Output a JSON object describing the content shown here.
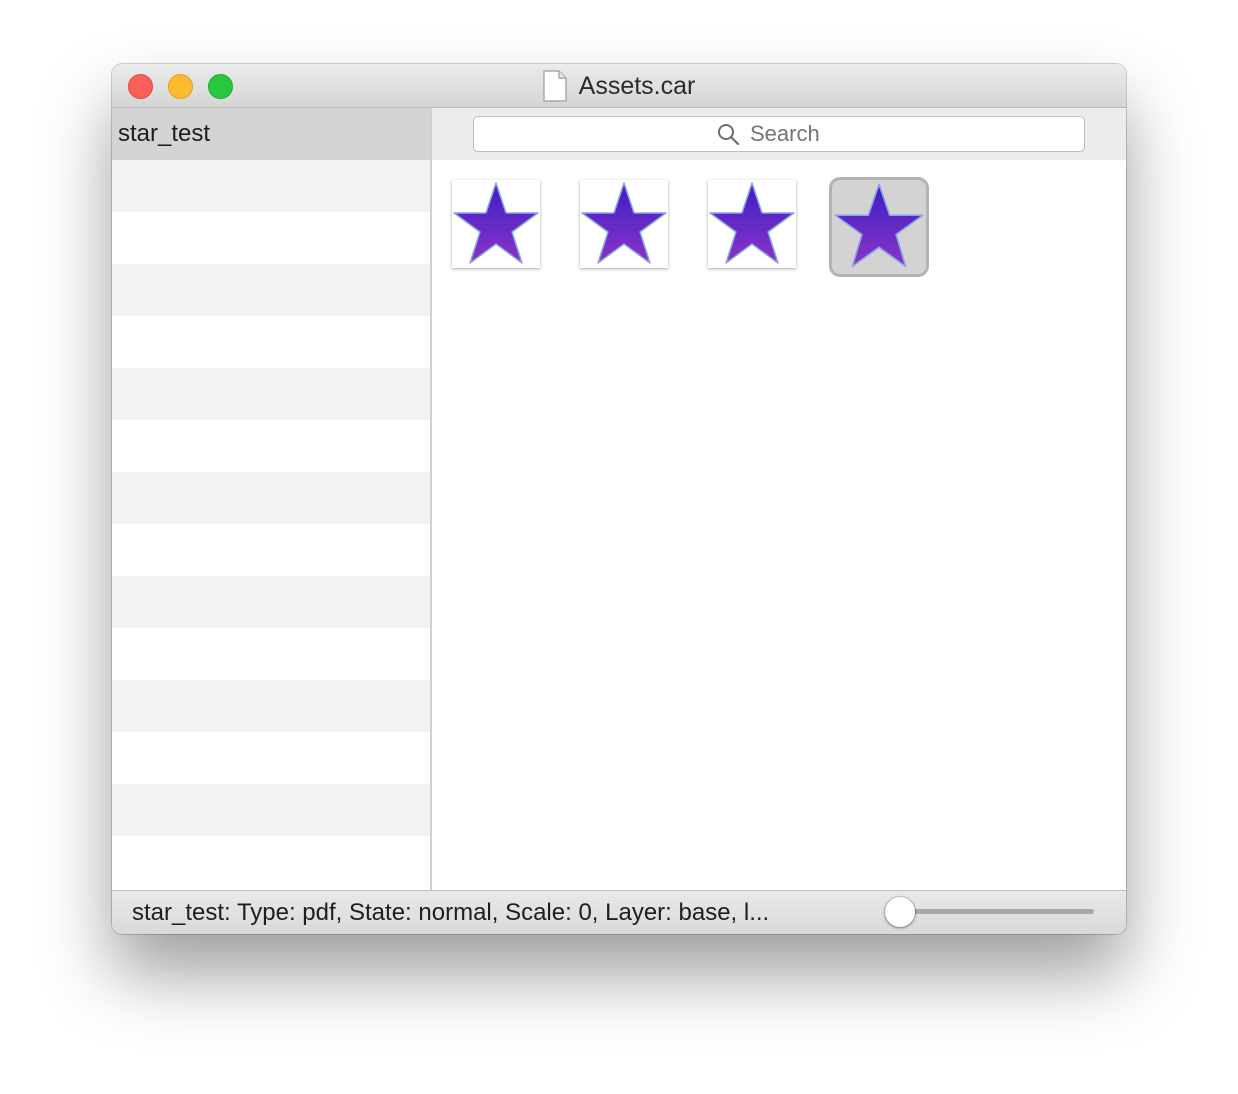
{
  "window": {
    "title": "Assets.car",
    "title_icon": "document-icon"
  },
  "sidebar": {
    "items": [
      {
        "label": "star_test",
        "selected": true
      }
    ]
  },
  "search": {
    "placeholder": "Search",
    "value": ""
  },
  "assets": [
    {
      "name": "star-thumbnail",
      "icon": "star",
      "selected": false
    },
    {
      "name": "star-thumbnail",
      "icon": "star",
      "selected": false
    },
    {
      "name": "star-thumbnail",
      "icon": "star",
      "selected": false
    },
    {
      "name": "star-thumbnail",
      "icon": "star",
      "selected": true
    }
  ],
  "status": {
    "text": "star_test: Type: pdf, State: normal, Scale: 0, Layer: base, l...",
    "zoom_slider_value": 0
  },
  "colors": {
    "star_top": "#3b1fc1",
    "star_bottom": "#8b34c8",
    "close": "#fc5f57",
    "minimize": "#fdbc2e",
    "maximize": "#29c73f"
  }
}
